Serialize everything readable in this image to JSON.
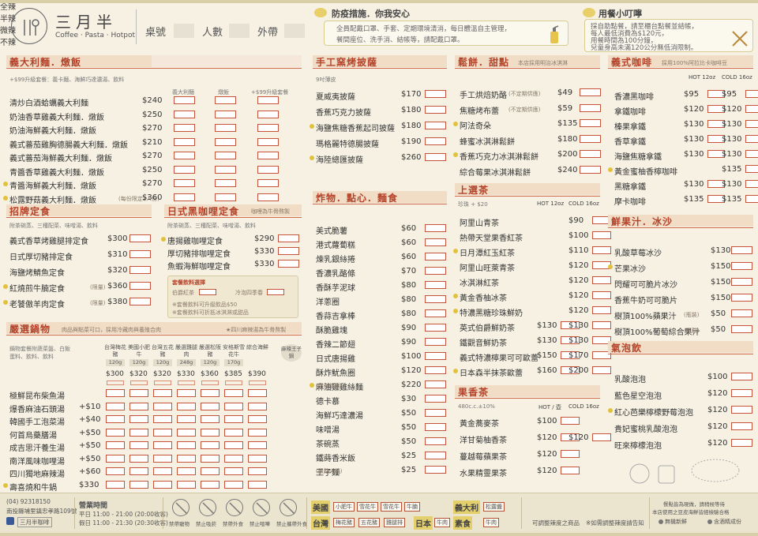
{
  "header": {
    "brand": "三月半",
    "tagline": "Coffee · Pasta · Hotpot",
    "fields": [
      "桌號",
      "人數",
      "外帶"
    ]
  },
  "notices": {
    "safety_title": "防疫措施．你我安心",
    "safety_lines": [
      "全員配戴口罩、手套、定期環境清消，每日體溫自主管理，",
      "餐間座位、洗手消、結帳等，請配戴口罩。"
    ],
    "ordering_title": "用餐小叮嚀",
    "ordering_lines": [
      "採自助點餐，請至櫃台點餐並結帳，",
      "每人最低消費為$120元，",
      "用餐時間為100分鐘，",
      "兒童身高未滿120公分無低消限制。"
    ]
  },
  "sections": {
    "pasta": {
      "title": "義大利麵．燉飯",
      "note": "+$99升級套餐：義卡麵、海鮮巧達濃湯、飲料",
      "col_headers": [
        "義大利麵",
        "燉飯",
        "+$99升級套餐"
      ],
      "items": [
        {
          "name": "清炒白酒蛤蠣義大利麵",
          "price": "$240",
          "dot": false
        },
        {
          "name": "奶油香草雞義大利麵．燉飯",
          "price": "$250",
          "dot": false
        },
        {
          "name": "奶油海鮮義大利麵．燉飯",
          "price": "$270",
          "dot": false
        },
        {
          "name": "義式蕃茄雞胸德腸義大利麵．燉飯",
          "price": "$210",
          "dot": false
        },
        {
          "name": "義式蕃茄海鮮義大利麵．燉飯",
          "price": "$270",
          "dot": false
        },
        {
          "name": "青醬香草雞義大利麵．燉飯",
          "price": "$250",
          "dot": false
        },
        {
          "name": "青醬海鮮義大利麵．燉飯",
          "price": "$270",
          "dot": true
        },
        {
          "name": "松露野菇義大利麵．燉飯",
          "price": "$360",
          "dot": true,
          "note": "(每份限定2人份)"
        }
      ]
    },
    "set_meals": {
      "title": "招牌定食",
      "note": "附茶碗蒸、三種配菜、味噌湯、飲料",
      "items": [
        {
          "name": "義式香草烤雞腿排定食",
          "price": "$300",
          "dot": false
        },
        {
          "name": "日式厚切豬排定食",
          "price": "$310",
          "dot": false
        },
        {
          "name": "海鹽烤鯖魚定食",
          "price": "$320",
          "dot": false
        },
        {
          "name": "紅燒煎牛腩定食",
          "price": "$360",
          "dot": true,
          "note": "(限量)"
        },
        {
          "name": "老饕傲羊肉定食",
          "price": "$380",
          "dot": true,
          "note": "(限量)"
        }
      ]
    },
    "curry": {
      "title": "日式黑咖哩定食",
      "title_note": "咖哩為牛骨熬製",
      "note": "附茶碗蒸、三種配菜、味噌湯、飲料",
      "items": [
        {
          "name": "唐揚雞咖哩定食",
          "price": "$290",
          "dot": true
        },
        {
          "name": "厚切豬排咖哩定食",
          "price": "$330",
          "dot": false
        },
        {
          "name": "魚蝦海鮮咖哩定食",
          "price": "$330",
          "dot": false
        }
      ],
      "options_title": "套餐飲料選擇",
      "option_hot": "伯爵紅茶",
      "option_cold": "冷泡四季春",
      "option_notes": [
        "※套餐飲料可升級飲品$50",
        "※套餐飲料可折抵冰淇淋或甜品"
      ]
    },
    "hotpot": {
      "title": "嚴選鍋物",
      "title_note": "肉品與點菜可口，採用冷藏肉與養殖合肉",
      "spicy_note": "★四川麻辣湯為牛骨熬製",
      "desc_lines": [
        "鍋物套餐附蔬菜盤、白飯",
        "蛋料、飲料、飲料"
      ],
      "meats": [
        {
          "name": "台灣梅花豬",
          "wt": "120g",
          "price": "$300"
        },
        {
          "name": "美國小肥牛",
          "wt": "120g",
          "price": "$320"
        },
        {
          "name": "台灣五花豬",
          "wt": "120g",
          "price": "$320"
        },
        {
          "name": "嚴選雞腿肉",
          "wt": "248g",
          "price": "$330"
        },
        {
          "name": "嚴選松阪豬",
          "wt": "120g",
          "price": "$360"
        },
        {
          "name": "安格斯雪花牛",
          "wt": "170g",
          "price": "$385"
        },
        {
          "name": "綜合海鮮",
          "wt": "",
          "price": "$390"
        }
      ],
      "spicy_label": "麻辣王子鍋",
      "soups": [
        {
          "name": "極鮮昆布柴魚湯",
          "price": "",
          "dot": false
        },
        {
          "name": "爆香麻油石頭湯",
          "price": "+$10",
          "dot": false
        },
        {
          "name": "韓國手工泡菜湯",
          "price": "+$40",
          "dot": false
        },
        {
          "name": "何首烏藥膳湯",
          "price": "+$50",
          "dot": false
        },
        {
          "name": "成吉思汗養生湯",
          "price": "+$50",
          "dot": false
        },
        {
          "name": "南洋風味咖哩湯",
          "price": "+$50",
          "dot": false
        },
        {
          "name": "四川獨地麻辣湯",
          "price": "+$60",
          "dot": false
        },
        {
          "name": "壽喜燒和牛鍋",
          "price": "$330",
          "dot": true
        }
      ]
    },
    "pizza": {
      "title": "手工窯烤披薩",
      "note": "9吋薄皮",
      "items": [
        {
          "name": "夏威夷披薩",
          "price": "$170",
          "dot": false
        },
        {
          "name": "香蕉巧克力披薩",
          "price": "$180",
          "dot": false
        },
        {
          "name": "海鹽焦糖香蕉起司披薩",
          "price": "$180",
          "dot": true
        },
        {
          "name": "瑪格麗特德腸披薩",
          "price": "$190",
          "dot": false
        },
        {
          "name": "海陸總匯披薩",
          "price": "$260",
          "dot": true
        }
      ]
    },
    "snacks": {
      "title": "炸物．點心．麵食",
      "items": [
        {
          "name": "美式脆薯",
          "price": "$60",
          "dot": false
        },
        {
          "name": "港式蘿蔔糕",
          "price": "$60",
          "dot": false
        },
        {
          "name": "煉乳銀絲捲",
          "price": "$60",
          "dot": false
        },
        {
          "name": "香濃乳酪條",
          "price": "$70",
          "dot": false
        },
        {
          "name": "香酥芋泥球",
          "price": "$80",
          "dot": false
        },
        {
          "name": "洋蔥圈",
          "price": "$80",
          "dot": false
        },
        {
          "name": "香蒜吉拿棒",
          "price": "$80",
          "dot": false
        },
        {
          "name": "酥脆雞塊",
          "price": "$90",
          "dot": false
        },
        {
          "name": "香辣二節翅",
          "price": "$90",
          "dot": false
        },
        {
          "name": "日式唐揚雞",
          "price": "$100",
          "dot": false
        },
        {
          "name": "酥炸魷魚圈",
          "price": "$120",
          "dot": false
        },
        {
          "name": "麻油雞雞絲麵",
          "price": "$220",
          "dot": true,
          "note": "(限量供應)"
        },
        {
          "name": "德卡慕",
          "price": "$30",
          "dot": false
        },
        {
          "name": "海鮮巧達濃湯",
          "price": "$50",
          "dot": false
        },
        {
          "name": "味噌湯",
          "price": "$50",
          "dot": false
        },
        {
          "name": "茶碗蒸",
          "price": "$50",
          "dot": false
        },
        {
          "name": "鐵蒔香米飯",
          "price": "$25",
          "dot": false
        },
        {
          "name": "王子麵",
          "price": "$25",
          "dot": false,
          "note": "(限點火鍋)"
        }
      ]
    },
    "waffles": {
      "title": "鬆餅．甜點",
      "title_note": "本店採用明治冰淇淋",
      "items": [
        {
          "name": "手工烘焙奶酪",
          "price": "$49",
          "dot": false,
          "note": "(不定期供應)"
        },
        {
          "name": "焦糖烤布蕾",
          "price": "$59",
          "dot": false,
          "note": "(不定期供應)"
        },
        {
          "name": "阿法奇朵",
          "price": "$135",
          "dot": true
        },
        {
          "name": "蜂蜜冰淇淋鬆餅",
          "price": "$180",
          "dot": false
        },
        {
          "name": "香蕉巧克力冰淇淋鬆餅",
          "price": "$200",
          "dot": true
        },
        {
          "name": "綜合莓果冰淇淋鬆餅",
          "price": "$240",
          "dot": false
        }
      ]
    },
    "tea": {
      "title": "上選茶",
      "note": "珍珠 + $20",
      "hot_label": "HOT 12oz",
      "cold_label": "COLD 16oz",
      "items": [
        {
          "name": "阿里山青茶",
          "hot": "",
          "cold": "$90",
          "dot": false
        },
        {
          "name": "熱帶天堂果香紅茶",
          "hot": "",
          "cold": "$100",
          "dot": false
        },
        {
          "name": "日月潭紅玉紅茶",
          "hot": "",
          "cold": "$110",
          "dot": true
        },
        {
          "name": "阿里山旺萊青茶",
          "hot": "",
          "cold": "$120",
          "dot": false
        },
        {
          "name": "冰淇淋紅茶",
          "hot": "",
          "cold": "$120",
          "dot": false
        },
        {
          "name": "黃金香柚冰茶",
          "hot": "",
          "cold": "$120",
          "dot": true
        },
        {
          "name": "特濃黑糖珍珠鮮奶",
          "hot": "",
          "cold": "$120",
          "dot": true
        },
        {
          "name": "英式伯爵鮮奶茶",
          "hot": "$130",
          "cold": "$130",
          "dot": false
        },
        {
          "name": "鐵觀音鮮奶茶",
          "hot": "$130",
          "cold": "$130",
          "dot": false
        },
        {
          "name": "義式特濃檸果可可歐蕾",
          "hot": "$150",
          "cold": "$170",
          "dot": false
        },
        {
          "name": "日本森半抹茶歐蕾",
          "hot": "$160",
          "cold": "$200",
          "dot": true
        }
      ]
    },
    "fruit_tea": {
      "title": "果香茶",
      "note": "480c.c.±10%",
      "hot_label": "HOT / 壺",
      "cold_label": "COLD 16oz",
      "items": [
        {
          "name": "黃金蕎麥茶",
          "hot": "$100",
          "cold": "",
          "dot": false
        },
        {
          "name": "洋甘菊柚香茶",
          "hot": "$120",
          "cold": "$120",
          "dot": false
        },
        {
          "name": "蔓越莓蘋果茶",
          "hot": "$120",
          "cold": "",
          "dot": false
        },
        {
          "name": "水果精靈果茶",
          "hot": "$120",
          "cold": "",
          "dot": false
        }
      ]
    },
    "coffee": {
      "title": "義式咖啡",
      "title_note": "採用100%阿拉比卡咖啡豆",
      "hot_label": "HOT 12oz",
      "cold_label": "COLD 16oz",
      "items": [
        {
          "name": "香濃黑咖啡",
          "hot": "$95",
          "cold": "$95",
          "dot": false
        },
        {
          "name": "拿鐵咖啡",
          "hot": "$120",
          "cold": "$120",
          "dot": false
        },
        {
          "name": "榛果拿鐵",
          "hot": "$130",
          "cold": "$130",
          "dot": false
        },
        {
          "name": "香草拿鐵",
          "hot": "$130",
          "cold": "$130",
          "dot": false
        },
        {
          "name": "海鹽焦糖拿鐵",
          "hot": "$130",
          "cold": "$130",
          "dot": false
        },
        {
          "name": "黃金蜜柚香檸咖啡",
          "hot": "",
          "cold": "$135",
          "dot": true
        },
        {
          "name": "黑糖拿鐵",
          "hot": "$130",
          "cold": "$130",
          "dot": false
        },
        {
          "name": "摩卡咖啡",
          "hot": "$135",
          "cold": "$135",
          "dot": false
        }
      ]
    },
    "juice": {
      "title": "鮮果汁．冰沙",
      "items": [
        {
          "name": "乳酸草莓冰沙",
          "price": "$130",
          "dot": false
        },
        {
          "name": "芒果冰沙",
          "price": "$150",
          "dot": true
        },
        {
          "name": "閃耀可可脆片冰沙",
          "price": "$150",
          "dot": false
        },
        {
          "name": "香蕉牛奶可可脆片",
          "price": "$150",
          "dot": false
        },
        {
          "name": "樹頂100%蘋果汁",
          "price": "$50",
          "dot": false,
          "note": "(瓶裝)"
        },
        {
          "name": "樹頂100%葡萄綜合果汁",
          "price": "$50",
          "dot": false,
          "note": "(瓶裝)"
        }
      ]
    },
    "sparkling": {
      "title": "氣泡飲",
      "items": [
        {
          "name": "乳酸泡泡",
          "price": "$100",
          "dot": false
        },
        {
          "name": "藍色星空泡泡",
          "price": "$120",
          "dot": false
        },
        {
          "name": "紅心芭樂檸檬野莓泡泡",
          "price": "$120",
          "dot": true
        },
        {
          "name": "貴妃蜜桃乳酸泡泡",
          "price": "$120",
          "dot": false
        },
        {
          "name": "旺來檸檬泡泡",
          "price": "$120",
          "dot": false
        }
      ]
    }
  },
  "footer": {
    "phone": "(04) 92318150",
    "address": "南投縣埔里鎮忠孝路109號",
    "fb": "三月半咖啡",
    "hours_title": "營業時間",
    "hours_weekday": "平日 11:00 - 21:00 (20:00收客)",
    "hours_weekend": "假日 11:00 - 21:30 (20:30收客)",
    "rules": [
      "禁帶寵物",
      "禁止吸菸",
      "禁帶外食",
      "禁止喧嘩",
      "禁止攜帶外食"
    ],
    "origin_us": "美國",
    "origin_tw": "台灣",
    "origin_it": "義大利",
    "origin_jp": "日本",
    "us_meats": [
      "小肥牛",
      "雪花牛",
      "雪花牛",
      "牛腩"
    ],
    "tw_meats": [
      "梅花豬",
      "五花豬",
      "雞腿排"
    ],
    "it_items": [
      "松露醬"
    ],
    "jp_items": [
      "牛肉"
    ],
    "spice_labels": [
      "全辣",
      "半辣",
      "微辣",
      "不辣"
    ],
    "spice_note1": "可調整辣度之商品",
    "spice_note2": "※如需調整辣度請告知",
    "veg_label": "素食",
    "notice_r1": "餐點皆為現做，請稍候等待",
    "notice_r2": "本店使用之豆皮海鮮皆經檢驗合格",
    "icon_notes": [
      "無機新鮮",
      "含酒精成份"
    ]
  }
}
